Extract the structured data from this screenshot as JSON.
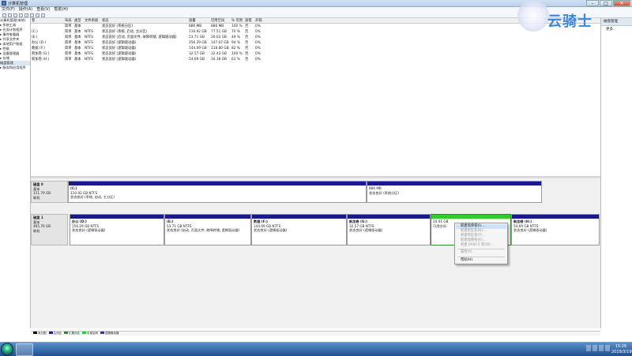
{
  "window": {
    "title": "计算机管理",
    "min": "–",
    "max": "□",
    "close": "✕"
  },
  "menu": [
    "文件(F)",
    "操作(A)",
    "查看(V)",
    "帮助(H)"
  ],
  "tree": [
    "计算机管理(本地)",
    "▸ 系统工具",
    "  ▸ 任务计划程序",
    "  ▸ 事件查看器",
    "  ▸ 共享文件夹",
    "  ▸ 本地用户和组",
    "  ▸ 性能",
    "  ▸ 设备管理器",
    "▸ 存储",
    "  磁盘管理",
    "▸ 服务和应用程序"
  ],
  "table": {
    "headers": [
      "卷",
      "布局",
      "类型",
      "文件系统",
      "状态",
      "容量",
      "可用空间",
      "% 可用",
      "容错",
      "开销"
    ],
    "rows": [
      [
        "",
        "简单",
        "基本",
        "",
        "状态良好 (系统分区)",
        "886 MB",
        "886 MB",
        "100 %",
        "否",
        "0%"
      ],
      [
        "(C:)",
        "简单",
        "基本",
        "NTFS",
        "状态良好 (系统, 启动, 主分区)",
        "110.92 GB",
        "77.51 GB",
        "70 %",
        "否",
        "0%"
      ],
      [
        "(E:)",
        "简单",
        "基本",
        "NTFS",
        "状态良好 (启动, 页面文件, 故障转储, 逻辑驱动器)",
        "53.71 GB",
        "26.03 GB",
        "49 %",
        "否",
        "0%"
      ],
      [
        "办公 (D:)",
        "简单",
        "基本",
        "NTFS",
        "状态良好 (逻辑驱动器)",
        "156.29 GB",
        "147.07 GB",
        "94 %",
        "否",
        "0%"
      ],
      [
        "数据 (F:)",
        "简单",
        "基本",
        "NTFS",
        "状态良好 (逻辑驱动器)",
        "144.09 GB",
        "118.80 GB",
        "82 %",
        "否",
        "0%"
      ],
      [
        "新加卷 (G:)",
        "简单",
        "基本",
        "NTFS",
        "状态良好 (逻辑驱动器)",
        "32.57 GB",
        "32.43 GB",
        "100 %",
        "否",
        "0%"
      ],
      [
        "新加卷 (H:)",
        "简单",
        "基本",
        "NTFS",
        "状态良好 (逻辑驱动器)",
        "54.69 GB",
        "34.38 GB",
        "63 %",
        "否",
        "0%"
      ]
    ]
  },
  "disk0": {
    "name": "磁盘 0",
    "type": "基本",
    "size": "111.79 GB",
    "state": "联机",
    "parts": [
      {
        "name": "(C:)",
        "size": "110.92 GB NTFS",
        "status": "状态良好 (系统, 启动, 主分区)"
      },
      {
        "name": "",
        "size": "886 MB",
        "status": "状态良好 (系统分区)"
      }
    ]
  },
  "disk1": {
    "name": "磁盘 1",
    "type": "基本",
    "size": "465.76 GB",
    "state": "联机",
    "parts": [
      {
        "name": "办公 (D:)",
        "size": "156.29 GB NTFS",
        "status": "状态良好 (逻辑驱动器)"
      },
      {
        "name": "(E:)",
        "size": "53.71 GB NTFS",
        "status": "状态良好 (启动, 页面文件, 故障转储, 逻辑驱动器)"
      },
      {
        "name": "数据 (F:)",
        "size": "144.09 GB NTFS",
        "status": "状态良好 (逻辑驱动器)"
      },
      {
        "name": "新加卷 (G:)",
        "size": "32.57 GB NTFS",
        "status": "状态良好 (逻辑驱动器)"
      },
      {
        "name": "",
        "size": "24.41 GB",
        "status": "可用空间"
      },
      {
        "name": "新加卷 (H:)",
        "size": "54.69 GB NTFS",
        "status": "状态良好 (逻辑驱动器)"
      }
    ]
  },
  "context_menu": [
    "新建简单卷(I)...",
    "新建跨区卷(N)...",
    "新建带区卷(T)...",
    "新建镜像卷(R)...",
    "新建 RAID-5 卷(W)...",
    "属性(P)",
    "帮助(H)"
  ],
  "actions": {
    "header": "磁盘管理",
    "more": "更多..."
  },
  "legend": [
    "未分配",
    "主分区",
    "扩展分区",
    "可用空间",
    "逻辑驱动器"
  ],
  "legend_colors": [
    "#000000",
    "#1a1a8a",
    "#2e8b2e",
    "#2ecc2e",
    "#3333aa"
  ],
  "clock": {
    "time": "15:26",
    "date": "2019/3/19"
  },
  "watermark": "云骑士"
}
